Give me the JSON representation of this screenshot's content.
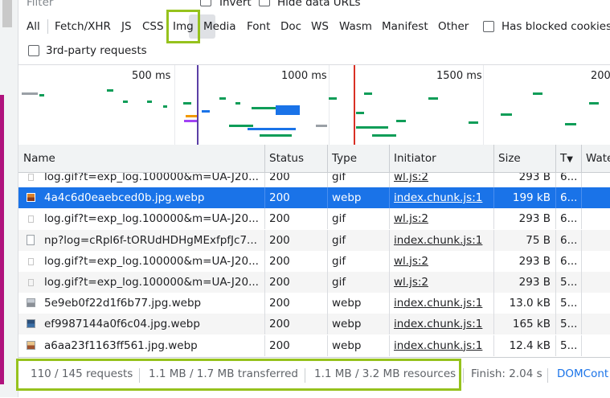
{
  "toolbar": {
    "filter_placeholder": "Filter",
    "invert_label": "Invert",
    "hide_data_urls_label": "Hide data URLs",
    "types": [
      "All",
      "Fetch/XHR",
      "JS",
      "CSS",
      "Img",
      "Media",
      "Font",
      "Doc",
      "WS",
      "Wasm",
      "Manifest",
      "Other"
    ],
    "selected_type": "Img",
    "has_blocked_cookies_label": "Has blocked cookies",
    "third_party_label": "3rd-party requests"
  },
  "overview": {
    "ticks": [
      "500 ms",
      "1000 ms",
      "1500 ms",
      "200"
    ]
  },
  "table": {
    "columns": [
      "Name",
      "Status",
      "Type",
      "Initiator",
      "Size",
      "T",
      "Wate"
    ],
    "rows": [
      {
        "name": "log.gif?t=exp_log.100000&m=UA-J20...",
        "status": "200",
        "type": "gif",
        "initiator": "wl.js:2",
        "size": "293 B",
        "time": "6...",
        "icon": "doc"
      },
      {
        "name": "4a4c6d0eaebced0b.jpg.webp",
        "status": "200",
        "type": "webp",
        "initiator": "index.chunk.js:1",
        "size": "199 kB",
        "time": "6...",
        "icon": "pic5",
        "selected": true
      },
      {
        "name": "log.gif?t=exp_log.100000&m=UA-J20...",
        "status": "200",
        "type": "gif",
        "initiator": "wl.js:2",
        "size": "293 B",
        "time": "6...",
        "icon": "doc"
      },
      {
        "name": "np?log=cRpl6f-tORUdHDHgMExfpfJc7...",
        "status": "200",
        "type": "gif",
        "initiator": "index.chunk.js:1",
        "size": "75 B",
        "time": "6...",
        "icon": "page"
      },
      {
        "name": "log.gif?t=exp_log.100000&m=UA-J20...",
        "status": "200",
        "type": "gif",
        "initiator": "wl.js:2",
        "size": "293 B",
        "time": "6...",
        "icon": "doc"
      },
      {
        "name": "log.gif?t=exp_log.100000&m=UA-J20...",
        "status": "200",
        "type": "gif",
        "initiator": "wl.js:2",
        "size": "293 B",
        "time": "5...",
        "icon": "doc"
      },
      {
        "name": "5e9eb0f22d1f6b77.jpg.webp",
        "status": "200",
        "type": "webp",
        "initiator": "index.chunk.js:1",
        "size": "13.0 kB",
        "time": "5...",
        "icon": "pic2"
      },
      {
        "name": "ef9987144a0f6c04.jpg.webp",
        "status": "200",
        "type": "webp",
        "initiator": "index.chunk.js:1",
        "size": "165 kB",
        "time": "5...",
        "icon": "pic3"
      },
      {
        "name": "a6aa23f1163ff561.jpg.webp",
        "status": "200",
        "type": "webp",
        "initiator": "index.chunk.js:1",
        "size": "12.4 kB",
        "time": "5...",
        "icon": "pic4"
      }
    ]
  },
  "statusbar": {
    "requests": "110 / 145 requests",
    "transferred": "1.1 MB / 1.7 MB transferred",
    "resources": "1.1 MB / 3.2 MB resources",
    "finish": "Finish: 2.04 s",
    "domcontent": "DOMCont"
  },
  "colors": {
    "highlight": "#96c21d",
    "selected_row": "#1a73e8",
    "waterfall_green": "#0f9d58",
    "waterfall_blue": "#1a73e8",
    "dom_line": "#5b3fa6",
    "load_line": "#d93025"
  }
}
